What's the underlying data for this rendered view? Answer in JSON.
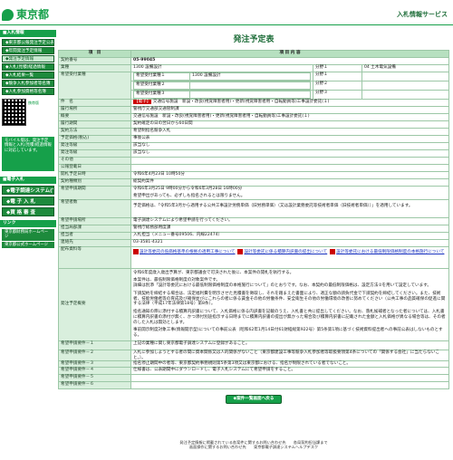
{
  "header": {
    "logo_text": "東京都",
    "service_title": "入札情報サービス"
  },
  "sidebar": {
    "head1": "■入札情報",
    "items": [
      "◆東京都公報発注予定公表",
      "◆年間発注予定情報",
      "◆発注予定情報",
      "◆入札(見積)経過情報",
      "◆入札結果一覧",
      "◆競争入札参加者等名簿",
      "◆入札参加資格等名簿"
    ],
    "qr_label": "携帯版",
    "mobile_note": "モバイル版は、発注予定情報と入札(見積)経過情報に対応しています。",
    "head2": "■電子入札",
    "big_items": [
      "◆電子調達システム(TOP)",
      "◆電 子 入 札",
      "◆資 格 審 査"
    ],
    "link_head": "リンク",
    "links": [
      "東京都財務局ホームページ",
      "東京都公式ホームページ"
    ]
  },
  "main": {
    "page_title": "発注予定表",
    "col_item": "項　目",
    "col_content": "項 目 内 容",
    "rows": {
      "contract_no_label": "契約番号",
      "contract_no": "05-99045",
      "category_label": "業種",
      "category_code": "1300 設備設計",
      "category_name": "1300 設備設計",
      "category_extra_label": "分野１",
      "category_extra": "04 土木電気設備",
      "desired_label": "希望受付業種",
      "desired": [
        {
          "label": "希望受付業種１",
          "value": "1300 設備設計",
          "split_label": "分野１",
          "split": ""
        },
        {
          "label": "希望受付業種２",
          "value": "",
          "split_label": "分野２",
          "split": ""
        },
        {
          "label": "希望受付業種３",
          "value": "",
          "split_label": "分野３",
          "split": ""
        }
      ],
      "name_label": "件　名",
      "name_tag": "【電子】",
      "name": "交通信号施設　新設・改良(視覚障害者用)・更新(視覚障害者用・自転動員等)工事設計委託(１)",
      "place_label": "履行場所",
      "place": "警視庁交通部交通管制課",
      "summary_label": "概要",
      "summary": "交通信号施設　新設・改良(視覚障害者用)・更新(視覚障害者用・自転動員等)工事設計委託(１)",
      "period_label": "履行期間",
      "period": "契約確定の日の翌日から60日間",
      "method_label": "契約方法",
      "method": "希望制指名競争入札",
      "price_label": "予定価格(税込)",
      "price": "事後公表",
      "announce_label": "発注等級",
      "announce": "該当なし",
      "reg_label": "発注等級",
      "reg": "該当なし",
      "other_label": "その他",
      "other": "",
      "date_label": "公報登載日",
      "date": "",
      "open_label": "開札予定日時",
      "open": "令和6年4月23日 10時50分",
      "type_label": "契約種類別",
      "type": "総契約案件",
      "apply_label": "希望申請期間",
      "apply": "令和6年3月25日 9時00分から令和6年3月28日 16時00分",
      "apply_note": "希望申出があっても、必ずしも指名されるとは限りません。",
      "desired_count_label": "希望者数",
      "desired_count": "予定価格は、「令和5年3月から適用する公共工事設計労務単価（旧労務単価）（又は設計業務委託等技術者単価（旧技術者単価））」を適用しています。",
      "apply_method_label": "希望申請場所",
      "apply_method": "電子調達システムにより希望申請を行ってください。",
      "office_label": "担当局部課",
      "office": "警視庁総務部用度課",
      "person_label": "担当者",
      "person": "入札担当（メニュー番号09506、内線22474）",
      "tel_label": "連絡先",
      "tel": "03-3581-4321",
      "docs_label": "配布資料等",
      "docs": [
        "設計等委託の低価格基準の根拠の適用工事について",
        "設計等委託に係る積算内訳書の提出について",
        "設計等委託における最低制限価格制度の本格施行について"
      ],
      "cond_label": "発注予定概要",
      "cond_intro": "令和6年度歳入歳出予算が、東京都議会で可決された後に、本案件の開札を執行する。",
      "cond_paras": [
        "本案件は、最低制限価格制度の対象案件です。",
        "詳細は別添「設計等委託における最低制限価格制度の本格施行について」のとおりです。なお、本契約の最低制限価格は、設定方法②を用いて設定しています。",
        "下請契約を締結する場合は、法定福利費を明示させた見積書を徴取し、それを踏まえた書面により、適正な額の請負代金で下請契約を締結してください。また、技術者、技能労働者等の育成及び確保並びにこれらの者に係る賃金その他の労働条件、安全衛生その他の労働環境の改善に努めてください（公共工事の品質確保の促進に関する法律（平成17年法律第18号）第8条）。",
        "指名通知の際に添付する積算内訳書について、入札価格に係る内訳書を記載のうえ、入札書と共に提出してください。なお、落札候補者となった者については、入札書に積算内訳書の添付が無く、かつ添付別途指示する日時までに積算内訳書の提出が無かった場合及び積算内訳書に記載された金額と入札価格が異なる場合等は、その者のした入札は無効とします。",
        "事前開示制度対象工事(情報開示型)についての事前公表（昭和62年1月14日付61財経総第922号）第5条第1項に基づく技術資料提出者への事前公表はしないものとする。"
      ],
      "req_rows": [
        {
          "label": "希望申請要件－１",
          "value": "上記の業種に関し東京都電子調達システムに登録があること。"
        },
        {
          "label": "希望申請要件－２",
          "value": "入札に参加しようとする者の間に資本関係又は人的関係がないこと（東京都建設工事等競争入札参加者等取扱要領第4条についての「関係する会社」に当たらないこと。）。"
        },
        {
          "label": "希望申請要件－３",
          "value": "指名停止期間中の者等、東京都契約事務規則第5条第3項又は東京都における、指名が制限されている者でないこと。"
        },
        {
          "label": "希望申請要件－４",
          "value": "仕様書は、公表期間中にダウンロードし、電子入札システムにて希望申請をすること。"
        },
        {
          "label": "希望申請要件－５",
          "value": ""
        },
        {
          "label": "希望申請要件－６",
          "value": ""
        }
      ]
    },
    "back_button": "◆案件一覧画面へ戻る"
  },
  "footer": {
    "line1": "発注予定情報に掲載されている各案件に関するお問い合わせ先　　各局契約担当課まで",
    "line2": "画面操作に関するお問い合わせ先　　東京都電子調達システムヘルプデスク"
  }
}
